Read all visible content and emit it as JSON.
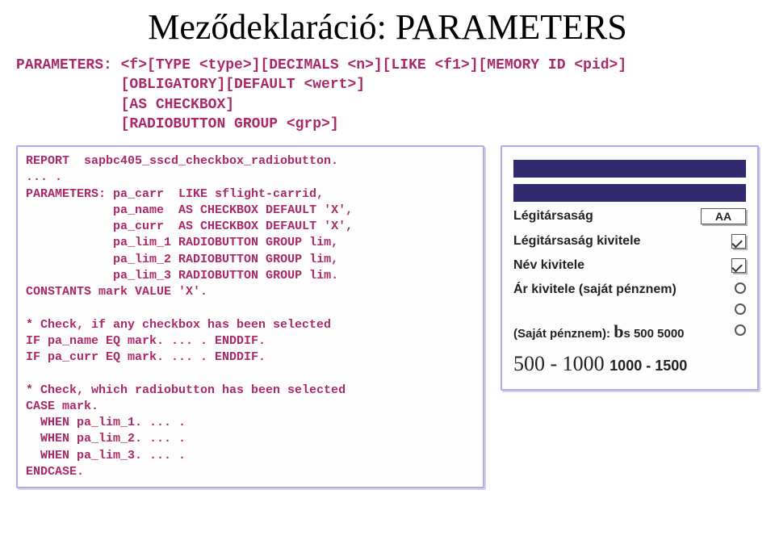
{
  "title": "Meződeklaráció: PARAMETERS",
  "syntax": "PARAMETERS: <f>[TYPE <type>][DECIMALS <n>][LIKE <f1>][MEMORY ID <pid>]\n            [OBLIGATORY][DEFAULT <wert>]\n            [AS CHECKBOX]\n            [RADIOBUTTON GROUP <grp>]",
  "code": "REPORT  sapbc405_sscd_checkbox_radiobutton.\n... .\nPARAMETERS: pa_carr  LIKE sflight-carrid,\n            pa_name  AS CHECKBOX DEFAULT 'X',\n            pa_curr  AS CHECKBOX DEFAULT 'X',\n            pa_lim_1 RADIOBUTTON GROUP lim,\n            pa_lim_2 RADIOBUTTON GROUP lim,\n            pa_lim_3 RADIOBUTTON GROUP lim.\nCONSTANTS mark VALUE 'X'.\n\n* Check, if any checkbox has been selected\nIF pa_name EQ mark. ... . ENDDIF.\nIF pa_curr EQ mark. ... . ENDDIF.\n\n* Check, which radiobutton has been selected\nCASE mark.\n  WHEN pa_lim_1. ... .\n  WHEN pa_lim_2. ... .\n  WHEN pa_lim_3. ... .\nENDCASE.",
  "panel": {
    "airline_label": "Légitársaság",
    "airline_value": "AA",
    "airline_output": "Légitársaság kivitele",
    "name_output": "Név kivitele",
    "price_output": "Ár kivitele (saját pénznem)",
    "own_currency_prefix": "(Saját pénznem): ",
    "own_currency_value": "s 500 5000",
    "range_main": "500 - 1000",
    "range_small": "1000 - 1500"
  }
}
